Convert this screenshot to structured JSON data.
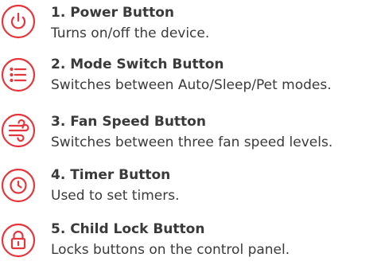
{
  "accent_color": "#e5363d",
  "items": [
    {
      "title": "1. Power Button",
      "desc": "Turns on/off the device.",
      "icon": "power-icon"
    },
    {
      "title": "2. Mode Switch Button",
      "desc": "Switches between Auto/Sleep/Pet modes.",
      "icon": "menu-list-icon"
    },
    {
      "title": "3. Fan Speed Button",
      "desc": "Switches between three fan speed levels.",
      "icon": "wind-icon"
    },
    {
      "title": "4. Timer Button",
      "desc": "Used to set timers.",
      "icon": "clock-icon"
    },
    {
      "title": "5. Child Lock Button",
      "desc": "Locks buttons on the control panel.",
      "icon": "lock-icon"
    }
  ]
}
